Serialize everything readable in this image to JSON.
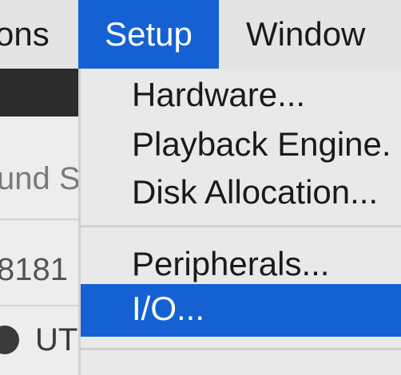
{
  "menubar": {
    "items": [
      {
        "label": "ons"
      },
      {
        "label": "Setup"
      },
      {
        "label": "Window"
      }
    ]
  },
  "background_window": {
    "row1_text": "und S",
    "row2_text": "8181",
    "row3_text": "UT"
  },
  "setup_menu": {
    "items": [
      {
        "label": "Hardware..."
      },
      {
        "label": "Playback Engine."
      },
      {
        "label": "Disk Allocation..."
      },
      {
        "label": "Peripherals..."
      },
      {
        "label": "I/O..."
      }
    ],
    "selected": "I/O..."
  },
  "colors": {
    "highlight": "#1561d3",
    "menu_bg": "#e9e9e9"
  }
}
